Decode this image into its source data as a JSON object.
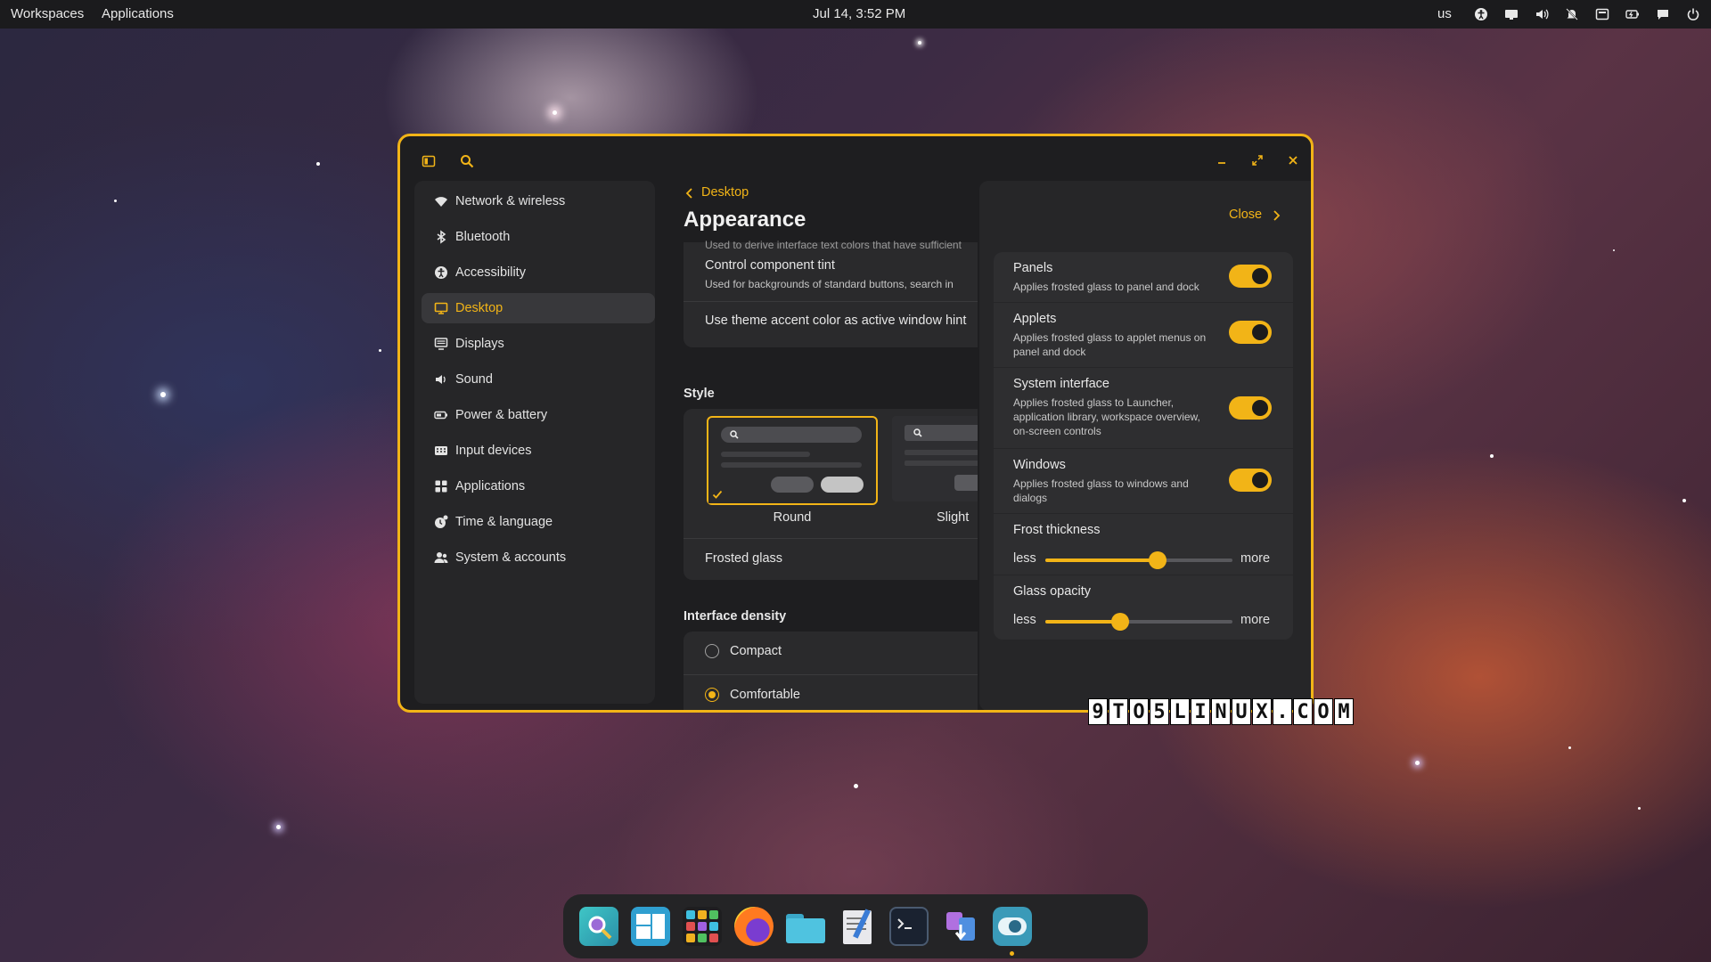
{
  "topbar": {
    "workspaces": "Workspaces",
    "applications": "Applications",
    "datetime": "Jul 14, 3:52 PM",
    "keyboard": "us",
    "tray_icons": [
      "accessibility-icon",
      "display-icon",
      "volume-icon",
      "notifications-off-icon",
      "screenshot-icon",
      "battery-icon",
      "chat-icon",
      "power-icon"
    ]
  },
  "window": {
    "accent_color": "#f2b417",
    "sidebar": {
      "items": [
        {
          "label": "Network & wireless",
          "icon": "wifi-icon"
        },
        {
          "label": "Bluetooth",
          "icon": "bluetooth-icon"
        },
        {
          "label": "Accessibility",
          "icon": "accessibility-icon"
        },
        {
          "label": "Desktop",
          "icon": "desktop-icon",
          "active": true
        },
        {
          "label": "Displays",
          "icon": "displays-icon"
        },
        {
          "label": "Sound",
          "icon": "sound-icon"
        },
        {
          "label": "Power & battery",
          "icon": "battery-icon"
        },
        {
          "label": "Input devices",
          "icon": "keyboard-icon"
        },
        {
          "label": "Applications",
          "icon": "apps-grid-icon"
        },
        {
          "label": "Time & language",
          "icon": "clock-icon"
        },
        {
          "label": "System & accounts",
          "icon": "users-icon"
        }
      ]
    },
    "main": {
      "breadcrumb": "Desktop",
      "title": "Appearance",
      "partial_text": "Used to derive interface text colors that have sufficient",
      "control_tint_title": "Control component tint",
      "control_tint_desc": "Used for backgrounds of standard buttons, search in",
      "accent_hint": "Use theme accent color as active window hint",
      "style_header": "Style",
      "style_options": [
        {
          "label": "Round",
          "selected": true
        },
        {
          "label": "Slight",
          "selected": false
        }
      ],
      "frosted_glass": "Frosted glass",
      "density_header": "Interface density",
      "density_options": [
        {
          "label": "Compact",
          "selected": false
        },
        {
          "label": "Comfortable",
          "selected": true
        }
      ]
    },
    "panel": {
      "close_label": "Close",
      "toggles": [
        {
          "title": "Panels",
          "desc": "Applies frosted glass to panel and dock",
          "on": true
        },
        {
          "title": "Applets",
          "desc": "Applies frosted glass to applet menus on panel and dock",
          "on": true
        },
        {
          "title": "System interface",
          "desc": "Applies frosted glass to Launcher, application library, workspace overview, on-screen controls",
          "on": true
        },
        {
          "title": "Windows",
          "desc": "Applies frosted glass to windows and dialogs",
          "on": true
        }
      ],
      "frost_thickness": {
        "title": "Frost thickness",
        "less": "less",
        "more": "more",
        "value_fraction": 0.6
      },
      "glass_opacity": {
        "title": "Glass opacity",
        "less": "less",
        "more": "more",
        "value_fraction": 0.4
      }
    }
  },
  "watermark": "9TO5LINUX.COM",
  "dock": {
    "apps": [
      "launcher-icon",
      "workspaces-icon",
      "app-library-icon",
      "firefox-icon",
      "files-icon",
      "text-editor-icon",
      "terminal-icon",
      "store-icon",
      "settings-icon"
    ]
  }
}
